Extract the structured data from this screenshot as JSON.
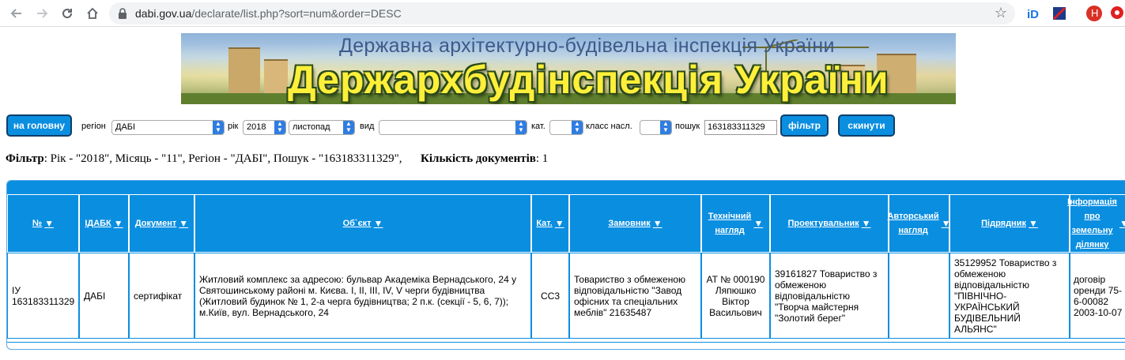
{
  "browser": {
    "url_host": "dabi.gov.ua",
    "url_path": "/declarate/list.php?sort=num&order=DESC",
    "profile_initial": "H",
    "colors": {
      "profile": "#d93025",
      "ext_red": "#e02020"
    }
  },
  "banner": {
    "title_top": "Державна архітектурно-будівельна інспекція України",
    "title_main": "Держархбудінспекція України"
  },
  "filter_bar": {
    "home_button": "на головну",
    "region_label": "регіон",
    "region_value": "ДАБІ",
    "year_label": "рік",
    "year_value": "2018",
    "month_value": "листопад",
    "kind_label": "вид",
    "kind_value": "",
    "cat_label": "кат.",
    "cat_value": "",
    "class_label": "класс насл.",
    "class_value": "",
    "search_label": "пошук",
    "search_value": "163183311329",
    "filter_button": "фільтр",
    "reset_button": "скинути"
  },
  "summary": {
    "filter_label": "Фільтр",
    "filter_text": ": Рік - \"2018\", Місяць - \"11\", Регіон - \"ДАБІ\", Пошук - \"163183311329\",",
    "count_label": "Кількість документів",
    "count_value": ": 1"
  },
  "table": {
    "headers": [
      {
        "label": "№"
      },
      {
        "label": "ІДАБК"
      },
      {
        "label": "Документ"
      },
      {
        "label": "Об`єкт"
      },
      {
        "label": "Кат."
      },
      {
        "label": "Замовник"
      },
      {
        "label": "Технічний нагляд"
      },
      {
        "label": "Проектувальник"
      },
      {
        "label": "Авторський нагляд"
      },
      {
        "label": "Підрядник"
      },
      {
        "label": "Інформація про земельну ділянку"
      }
    ],
    "rows": [
      {
        "num": "ІУ 163183311329",
        "idabk": "ДАБІ",
        "document": "сертифікат",
        "object": "Житловий комплекс за адресою: бульвар Академіка Вернадського, 24 у Святошинському районі м. Києва. І, ІІ, ІІІ, ІV, V черги будівництва (Житловий будинок № 1, 2-а черга будівництва; 2 п.к. (секції - 5, 6, 7)); м.Київ, вул. Вернадського, 24",
        "cat": "СС3",
        "customer": "Товариство з обмеженою відповідальністю \"Завод офісних та спеціальних меблів\" 21635487",
        "tech_supervision": "АТ № 000190 Ляпюшко Віктор Васильович",
        "designer": "39161827 Товариство з обмеженою відповідальністю \"Творча майстерня \"Золотий берег\"",
        "author_supervision": "",
        "contractor": "35129952 Товариство з обмеженою відповідальністю \"ПІВНІЧНО-УКРАЇНСЬКИЙ БУДІВЕЛЬНИЙ АЛЬЯНС\"",
        "land_info": "договір оренди 75-6-00082 2003-10-07"
      }
    ]
  },
  "colors": {
    "accent": "#0a8ee0",
    "button_border": "#0d3f6b",
    "select_arrow": "#2f7de1"
  }
}
